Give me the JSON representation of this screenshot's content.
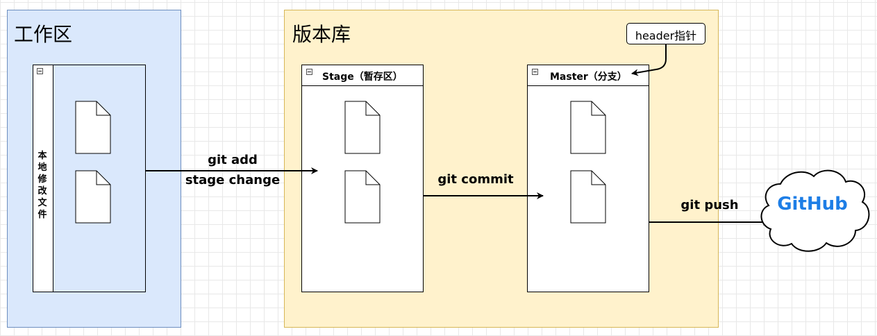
{
  "workspace": {
    "title": "工作区",
    "pool_label": [
      "本",
      "地",
      "修",
      "改",
      "文",
      "件"
    ]
  },
  "repository": {
    "title": "版本库",
    "stage_title": "Stage（暂存区）",
    "master_title": "Master（分支）",
    "header_pointer": "header指针"
  },
  "edges": {
    "git_add": "git add",
    "stage_change": "stage change",
    "git_commit": "git commit",
    "git_push": "git push"
  },
  "remote": {
    "label": "GitHub"
  },
  "colors": {
    "workspace_fill": "#dae8fc",
    "workspace_border": "#6c8ebf",
    "repository_fill": "#fff2cc",
    "repository_border": "#d6b656",
    "github_text": "#1e7ee6"
  },
  "icons": [
    "document-icon",
    "cloud-icon",
    "collapse-icon",
    "arrow"
  ]
}
